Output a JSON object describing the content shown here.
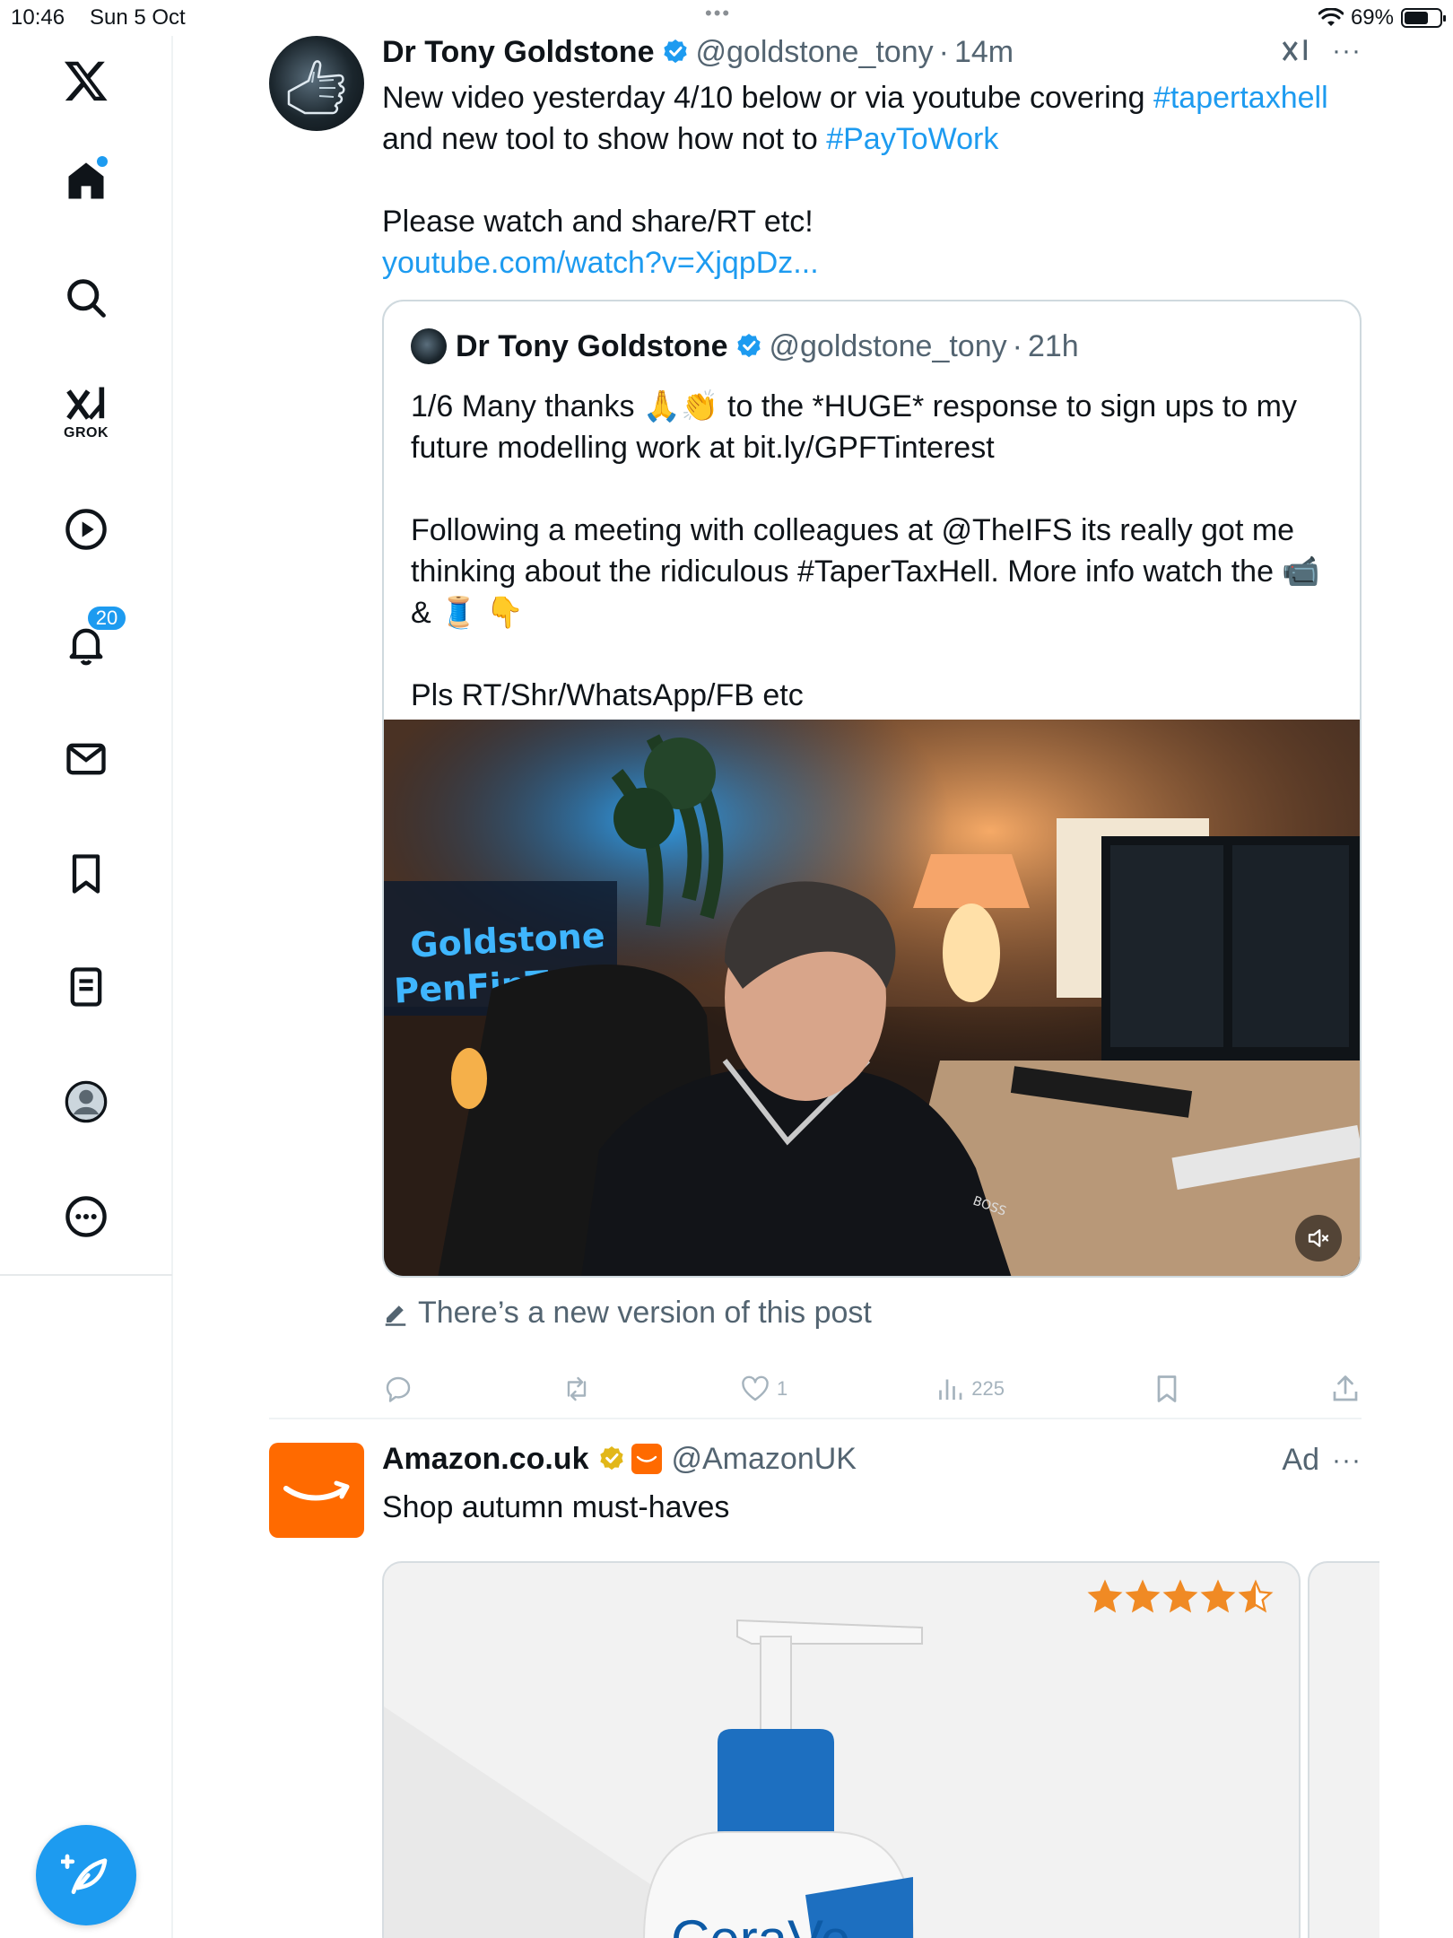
{
  "status_bar": {
    "time": "10:46",
    "date": "Sun 5 Oct",
    "battery_percent": "69%",
    "battery_level": 0.69,
    "multitask_dots": "•••"
  },
  "sidebar": {
    "notifications_badge": "20",
    "grok_label": "GROK"
  },
  "post": {
    "author_name": "Dr Tony Goldstone",
    "handle": "@goldstone_tony",
    "separator": "·",
    "time": "14m",
    "more": "···",
    "text_before_tag1": "New video yesterday 4/10 below or via youtube covering ",
    "hashtag1": "#tapertaxhell",
    "text_before_tag2": " and new tool to show how not to ",
    "hashtag2": "#PayToWork",
    "text_para2": "\n\nPlease watch and share/RT etc!\n",
    "link": "youtube.com/watch?v=XjqpDz...",
    "quote": {
      "author_name": "Dr Tony Goldstone",
      "handle": "@goldstone_tony",
      "separator": "·",
      "time": "21h",
      "text": "1/6 Many thanks 🙏👏 to the *HUGE* response to sign ups to my future modelling work at bit.ly/GPFTinterest\n\nFollowing a meeting with colleagues at @TheIFS its really got me thinking about the ridiculous #TaperTaxHell. More info watch the 📹 & 🧵 👇\n\nPls RT/Shr/WhatsApp/FB etc",
      "video_sign_line1": "Goldstone",
      "video_sign_line2": "PenFinTech",
      "shirt_logo": "BOSS"
    },
    "new_version_notice": "There’s a new version of this post",
    "actions": {
      "likes": "1",
      "views": "225"
    }
  },
  "ad": {
    "author_name": "Amazon.co.uk",
    "handle": "@AmazonUK",
    "ad_label": "Ad",
    "more": "···",
    "text": "Shop autumn must-haves",
    "rating_stars": 4.5,
    "product_brand": "CeraVe"
  },
  "colors": {
    "accent": "#1d9bf0",
    "amazon_orange": "#ff6a00",
    "star_orange": "#f08a24"
  }
}
